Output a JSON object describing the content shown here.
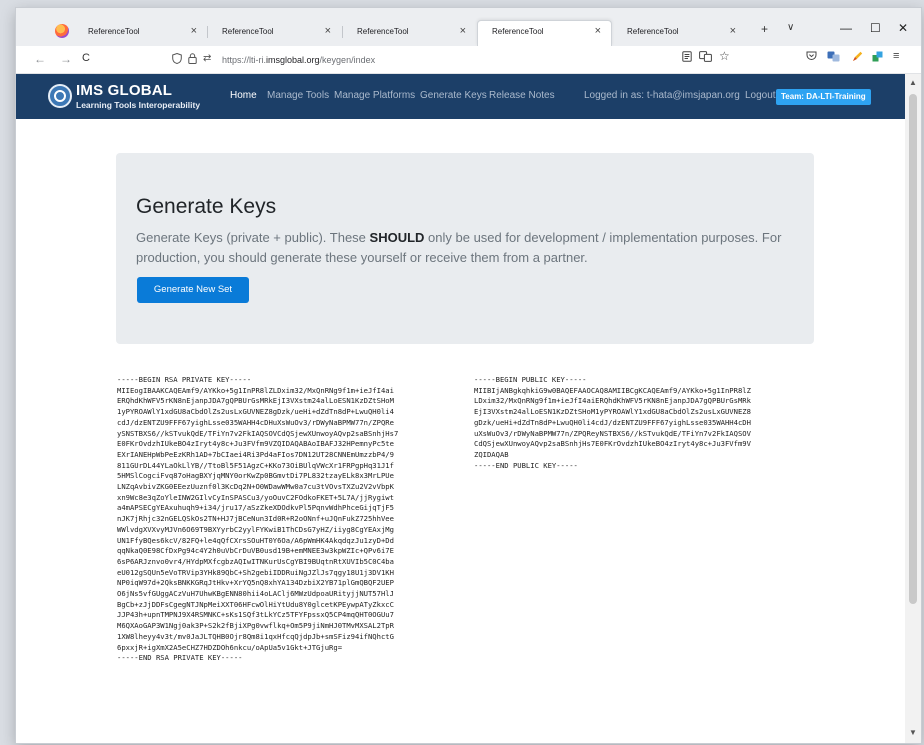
{
  "browser": {
    "tabs": [
      {
        "title": "ReferenceTool",
        "close": "×"
      },
      {
        "title": "ReferenceTool",
        "close": "×"
      },
      {
        "title": "ReferenceTool",
        "close": "×"
      },
      {
        "title": "ReferenceTool",
        "close": "×"
      },
      {
        "title": "ReferenceTool",
        "close": "×"
      }
    ],
    "new_tab": "+",
    "tab_list": "∨",
    "window_controls": {
      "minimize": "—",
      "maximize": "☐",
      "close": "✕"
    },
    "nav": {
      "back": "←",
      "forward": "→",
      "reload": "C"
    },
    "url": {
      "prefix": "https://lti-ri.",
      "domain": "imsglobal.org",
      "path": "/keygen/index"
    }
  },
  "site": {
    "brand_title": "IMS GLOBAL",
    "brand_subtitle": "Learning Tools Interoperability",
    "menu": [
      "Home",
      "Manage Tools",
      "Manage Platforms",
      "Generate Keys",
      "Release Notes"
    ],
    "logged_in": "Logged in as: t-hata@imsjapan.org",
    "logout": "Logout",
    "team": "Team: DA-LTI-Training"
  },
  "main": {
    "title": "Generate Keys",
    "lead_before": "Generate Keys (private + public). These ",
    "lead_strong": "SHOULD",
    "lead_after": " only be used for development / implementation purposes. For production, you should generate these yourself or receive them from a partner.",
    "button": "Generate New Set",
    "private_key": "-----BEGIN RSA PRIVATE KEY-----\nMIIEogIBAAKCAQEAmf9/AYKko+5g1InPR8lZLDxim32/MxQnRNg9f1m+ieJfI4ai\nERQhdKhWFV5rKN8nEjanpJDA7gQPBUrGsMRkEjI3VXstm24alLoESN1KzDZtSHoM\n1yPYROAWlY1xdGU8aCbdOlZs2usLxGUVNEZ8gDzk/ueHi+dZdTn8dP+LwuQH0li4\ncdJ/dzENTZU9FFF67yighLsse035WAHH4cDHuXsWuOv3/rDWyNaBPMW77n/ZPQRe\nySNSTBXS6//kSTvukQdE/TFiYn7v2FkIAQSOVCdQSjewXUnwoyAQvp2saBSnhjHs7\nE0FKrOvdzhIUkeBO4zIryt4y8c+Ju3FVfm9VZQIDAQABAoIBAFJ32HPemnyPc5te\nEXrIANEHpWbPeEzKRh1AD+7bCIaei4Ri3Pd4aFIos7DN12UT28CNNEmUmzzbP4/9\n811GUrDL44YLaOkLlYB//TtoBl5F51AgzC+KKo73OiBUlqVWcXr1FRPgpHq31J1f\n5HMSlCogciFvq87oHagBXYjqMNY0orKwZp0BGmvtDi7PL832tzayELk8x3MrLPUe\nLNZqAvbivZKG0EEezUuznf0l3KcDq2N+O0WDawWMw0a7cu3tVOvsTXZu2V2vVbpK\nxn9Wc8e3qZoYleINW2GIlvCyInSPASCu3/yoOuvC2FOdkoFKET+5L7A/jjRygiwt\na4mAPSECgYEAxuhuqh9+i34/jru17/aSzZkeXDOdkvPl5PqnvWdhPhceGijqTjF5\nnJK7jRhjc32nGELQSkOs2TN+HJ7jBCeNun3Id0R+R2oONnf+uJQnFukZ725hhVee\nWWlvdgXVXvyMJVn6O69T9BXYyrbC2yylFYKwiB1ThCDsG7yHZ/iiyg8CgYEAxjMg\nUN1FfyBQes6kcV/82FQ+le4qQfCXrsSOuHT0Y6Oa/A6pWmHK4AkqdqzJu1zyD+Dd\nqqNkaQ0E98CfDxPg94c4Y2h0uVbCrDuVB0usd19B+emMNEE3w3kpWZIc+QPv6i7E\n6sP6ARJznvo0vr4/HYdpMXfcgbzAQIwITNKurUsCgYBI9BUqtnRtXUVIb5C0C4ba\neU012gSQUn5eVoTRVip3YHk89QbC+Sh2gebiIDDRuiNgJZlJs7qgy18U1j3DV1KH\nNP0iqW97d+2QksBNKKGRqJtHkv+XrYQ5nQ8xhYA134DzbiX2YB71plGmQBQF2UEP\nO6jNs5vfGUggACzVuH7UhwKBgENN80hii4oLAClj6MWzUdpoaURityjjNUT57HlJ\nBgCb+zJjDDFsCgegNTJNpMeiXXT06HFcwOlHiYtUdu8Y0glcetKPEywpATyZkxcC\nJJP43h+upnTMPNJ9X4RSMNKC+sKs1SQf3tLkYCz5TFYFpssxQ5CP4mqQHT0OGUu7\nM6QXAoGAP3W1Ngj0ak3P+S2k2fBjiXPg0vwflkq+Om5P9jiNmHJ0TMvMXSAL2TpR\n1XW8lheyy4v3t/mv0JaJLTQHB0Ojr8Qm8i1qxHfcqQjdpJb+smSFiz94ifNQhctG\n6pxxjR+igXmX2A5eCHZ7HDZDOh6nkcu/oApUa5v1Gkt+JTGjuRg=\n-----END RSA PRIVATE KEY-----",
    "public_key": "-----BEGIN PUBLIC KEY-----\nMIIBIjANBgkqhkiG9w0BAQEFAAOCAQ8AMIIBCgKCAQEAmf9/AYKko+5g1InPR8lZ\nLDxim32/MxQnRNg9f1m+ieJfI4aiERQhdKhWFV5rKN8nEjanpJDA7gQPBUrGsMRk\nEjI3VXstm24alLoESN1KzDZtSHoM1yPYROAWlY1xdGU8aCbdOlZs2usLxGUVNEZ8\ngDzk/ueHi+dZdTn8dP+LwuQH0li4cdJ/dzENTZU9FFF67yighLsse035WAHH4cDH\nuXsWuOv3/rDWyNaBPMW77n/ZPQReyNSTBXS6//kSTvukQdE/TFiYn7v2FkIAQSOV\nCdQSjewXUnwoyAQvp2saBSnhjHs7E0FKrOvdzhIUkeBO4zIryt4y8c+Ju3FVfm9V\nZQIDAQAB\n-----END PUBLIC KEY-----"
  }
}
